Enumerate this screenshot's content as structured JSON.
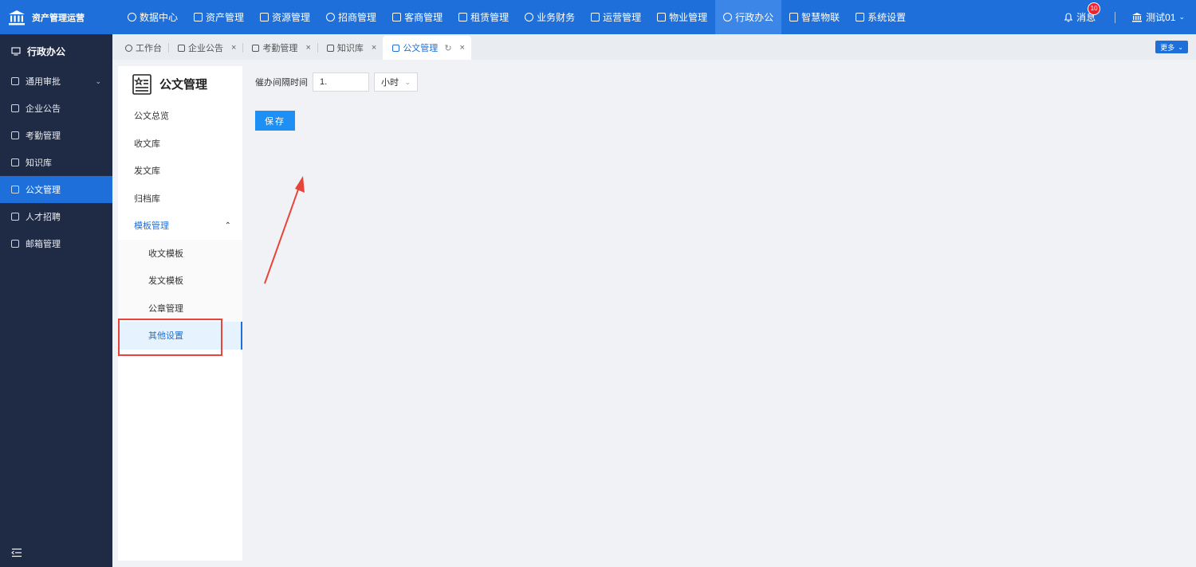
{
  "app": {
    "title": "资产管理运营"
  },
  "nav": [
    {
      "label": "数据中心",
      "icon": "dashboard-icon",
      "active": false
    },
    {
      "label": "资产管理",
      "icon": "box-icon",
      "active": false
    },
    {
      "label": "资源管理",
      "icon": "building-icon",
      "active": false
    },
    {
      "label": "招商管理",
      "icon": "tag-icon",
      "active": false
    },
    {
      "label": "客商管理",
      "icon": "people-icon",
      "active": false
    },
    {
      "label": "租赁管理",
      "icon": "house-icon",
      "active": false
    },
    {
      "label": "业务财务",
      "icon": "yen-icon",
      "active": false
    },
    {
      "label": "运营管理",
      "icon": "chart-icon",
      "active": false
    },
    {
      "label": "物业管理",
      "icon": "home-icon",
      "active": false
    },
    {
      "label": "行政办公",
      "icon": "monitor-icon",
      "active": true
    },
    {
      "label": "智慧物联",
      "icon": "atom-icon",
      "active": false
    },
    {
      "label": "系统设置",
      "icon": "gear-icon",
      "active": false
    }
  ],
  "header": {
    "messages_label": "消息",
    "messages_count": "10",
    "user_name": "测试01"
  },
  "sidebar": {
    "title": "行政办公",
    "items": [
      {
        "label": "通用审批",
        "icon": "document-icon",
        "active": false,
        "has_arrow": true
      },
      {
        "label": "企业公告",
        "icon": "speaker-icon",
        "active": false
      },
      {
        "label": "考勤管理",
        "icon": "calendar-icon",
        "active": false
      },
      {
        "label": "知识库",
        "icon": "book-icon",
        "active": false
      },
      {
        "label": "公文管理",
        "icon": "file-icon",
        "active": true
      },
      {
        "label": "人才招聘",
        "icon": "person-icon",
        "active": false
      },
      {
        "label": "邮箱管理",
        "icon": "mail-icon",
        "active": false
      }
    ]
  },
  "tabs": [
    {
      "label": "工作台",
      "closable": false,
      "active": false
    },
    {
      "label": "企业公告",
      "closable": true,
      "active": false
    },
    {
      "label": "考勤管理",
      "closable": true,
      "active": false
    },
    {
      "label": "知识库",
      "closable": true,
      "active": false
    },
    {
      "label": "公文管理",
      "closable": true,
      "active": true
    }
  ],
  "more_label": "更多",
  "panel": {
    "title": "公文管理",
    "items": [
      {
        "label": "公文总览"
      },
      {
        "label": "收文库"
      },
      {
        "label": "发文库"
      },
      {
        "label": "归档库"
      }
    ],
    "group": {
      "label": "模板管理",
      "sub_items": [
        {
          "label": "收文模板",
          "active": false
        },
        {
          "label": "发文模板",
          "active": false
        },
        {
          "label": "公章管理",
          "active": false
        },
        {
          "label": "其他设置",
          "active": true
        }
      ]
    }
  },
  "form": {
    "interval_label": "催办间隔时间",
    "interval_value": "1.",
    "unit_value": "小时",
    "save_label": "保存"
  },
  "colors": {
    "primary": "#1e6fd9",
    "sidebar_bg": "#1f2a44",
    "annotation": "#e8443a"
  }
}
